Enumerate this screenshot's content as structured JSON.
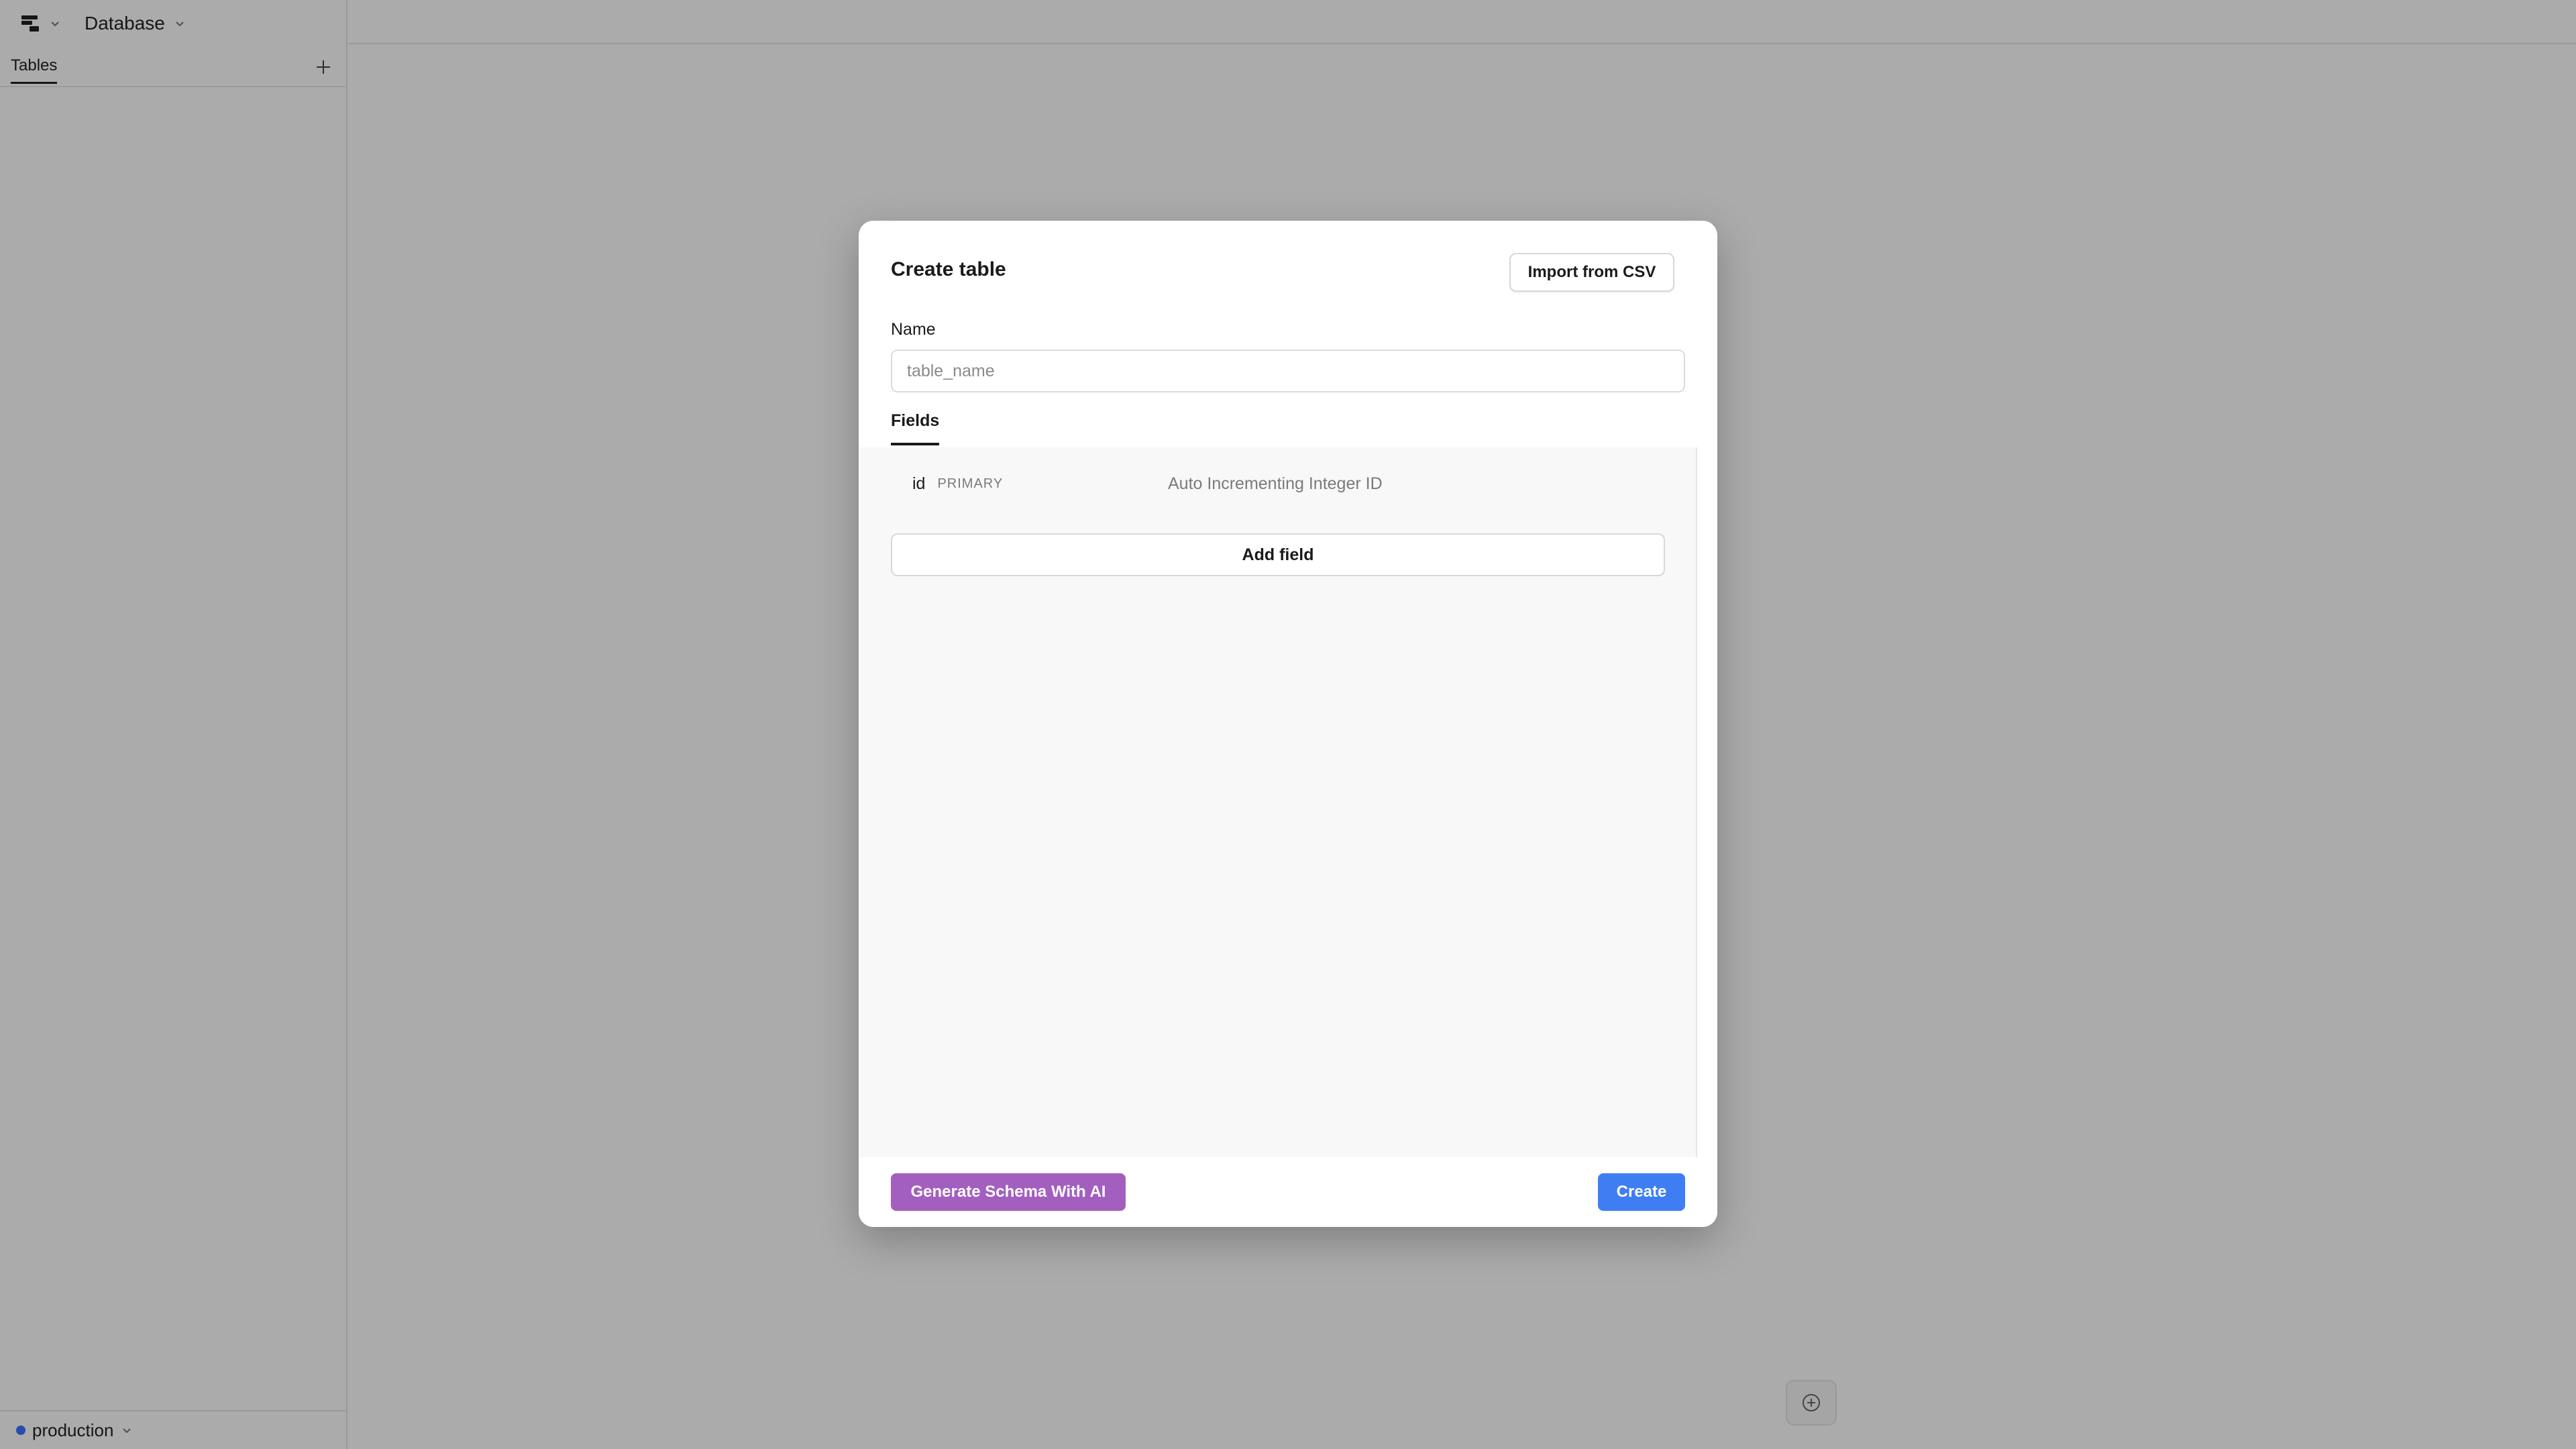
{
  "sidebar": {
    "logo_icon": "stacked-bars-logo-icon",
    "database_label": "Database",
    "tabs": [
      {
        "label": "Tables"
      }
    ],
    "add_icon": "plus-icon",
    "footer": {
      "environment": "production",
      "dot_color": "#3b74ff"
    }
  },
  "modal": {
    "title": "Create table",
    "import_label": "Import from CSV",
    "name_label": "Name",
    "name_placeholder": "table_name",
    "name_value": "",
    "fields_tab": "Fields",
    "fields": [
      {
        "name": "id",
        "badge": "PRIMARY",
        "description": "Auto Incrementing Integer ID"
      }
    ],
    "add_field_label": "Add field",
    "generate_label": "Generate Schema With AI",
    "create_label": "Create"
  },
  "colors": {
    "accent_purple": "#a35fbf",
    "accent_blue": "#3f7ef2"
  },
  "fab_icon": "plus-circle-icon"
}
